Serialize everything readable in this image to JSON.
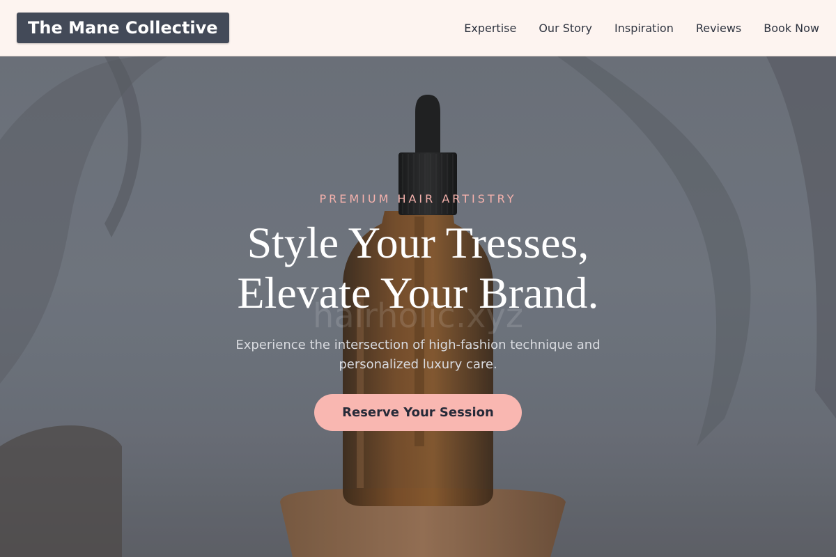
{
  "header": {
    "logo": "The Mane Collective",
    "nav": [
      {
        "label": "Expertise"
      },
      {
        "label": "Our Story"
      },
      {
        "label": "Inspiration"
      },
      {
        "label": "Reviews"
      },
      {
        "label": "Book Now"
      }
    ]
  },
  "hero": {
    "eyebrow": "PREMIUM HAIR ARTISTRY",
    "headline_line1": "Style Your Tresses,",
    "headline_line2": "Elevate Your Brand.",
    "subtext": "Experience the intersection of high-fashion technique and personalized luxury care.",
    "cta_label": "Reserve Your Session",
    "watermark": "hairholic.xyz"
  },
  "colors": {
    "header_bg": "#fdf4f0",
    "logo_bg": "#434a58",
    "accent": "#f9b7b1",
    "eyebrow": "#f6b2ad",
    "text_dark": "#262a38"
  }
}
